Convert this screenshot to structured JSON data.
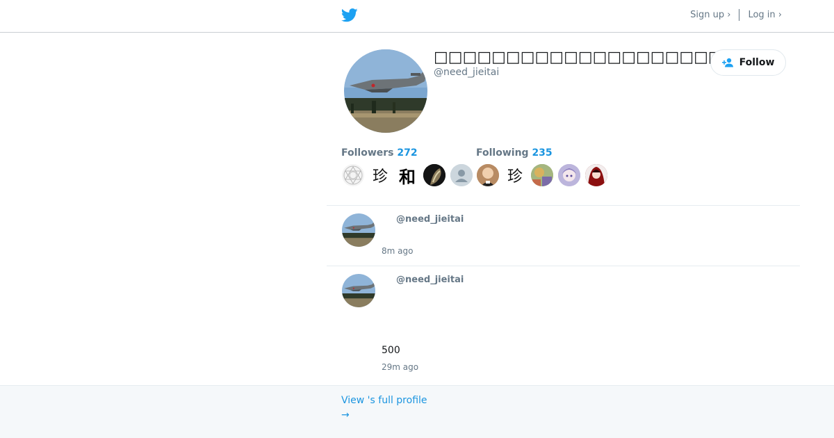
{
  "header": {
    "signup_label": "Sign up ›",
    "login_label": "Log in ›",
    "colors": {
      "brand": "#1da1f2",
      "link": "#1b95e0"
    }
  },
  "profile": {
    "display_name": "□□□□□□□□□□□□□□□□□□□□",
    "screen_name": "@need_jieitai",
    "follow_label": "Follow",
    "followers_label": "Followers",
    "followers_count": "272",
    "following_label": "Following",
    "following_count": "235"
  },
  "followers_faces": [
    {
      "kind": "geometric-sigil"
    },
    {
      "kind": "calligraphy",
      "char": "珍"
    },
    {
      "kind": "calligraphy",
      "char": "和"
    },
    {
      "kind": "dark-photo"
    },
    {
      "kind": "default-egg"
    }
  ],
  "following_faces": [
    {
      "kind": "person-photo"
    },
    {
      "kind": "calligraphy",
      "char": "珍"
    },
    {
      "kind": "colorful-photo"
    },
    {
      "kind": "anime-purple"
    },
    {
      "kind": "anime-red"
    }
  ],
  "tweets": [
    {
      "handle": "@need_jieitai",
      "text": "",
      "time": "8m ago"
    },
    {
      "handle": "@need_jieitai",
      "text": "500",
      "time": "29m ago"
    }
  ],
  "footer": {
    "view_profile_label": "View 's full profile",
    "arrow": "→"
  }
}
